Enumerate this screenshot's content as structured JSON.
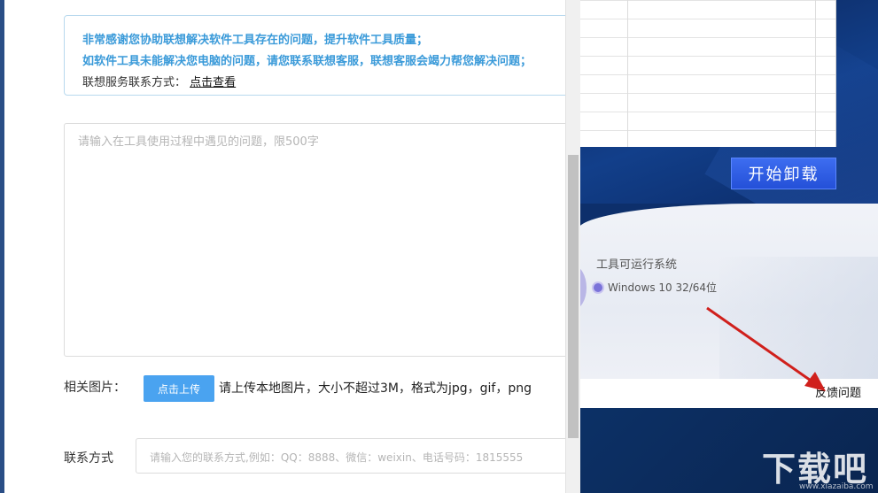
{
  "feedback_form": {
    "notice": {
      "line1": "非常感谢您协助联想解决软件工具存在的问题，提升软件工具质量；",
      "line2": "如软件工具未能解决您电脑的问题，请您联系联想客服，联想客服会竭力帮您解决问题；",
      "line3_label": "联想服务联系方式：",
      "line3_link": "点击查看"
    },
    "problem_placeholder": "请输入在工具使用过程中遇见的问题，限500字",
    "image_label": "相关图片：",
    "upload_button": "点击上传",
    "upload_hint": "请上传本地图片，大小不超过3M，格式为jpg，gif，png",
    "contact_label": "联系方式",
    "contact_placeholder": "请输入您的联系方式,例如：QQ：8888、微信：weixin、电话号码：1815555"
  },
  "uninstaller": {
    "start_button": "开始卸载",
    "os_title": "工具可运行系统",
    "os_item": "Windows 10 32/64位",
    "feedback_link": "反馈问题"
  },
  "watermark": {
    "text": "下载吧",
    "url": "www.xiazaiba.com"
  },
  "colors": {
    "accent_blue": "#3a9ad9",
    "upload_button": "#4aa3f0",
    "start_button": "#2450d8",
    "arrow": "#d0201c"
  }
}
